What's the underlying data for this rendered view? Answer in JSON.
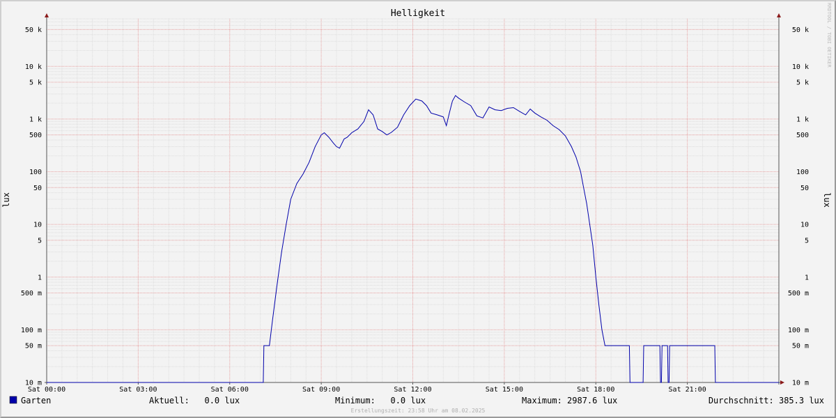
{
  "chart_data": {
    "type": "line",
    "title": "Helligkeit",
    "ylabel": "lux",
    "yscale": "log",
    "ylim": [
      0.01,
      80000
    ],
    "xlim": [
      0,
      24
    ],
    "y_ticks": [
      {
        "value": 50000,
        "label": "50 k"
      },
      {
        "value": 10000,
        "label": "10 k"
      },
      {
        "value": 5000,
        "label": "5 k"
      },
      {
        "value": 1000,
        "label": "1 k"
      },
      {
        "value": 500,
        "label": "500"
      },
      {
        "value": 100,
        "label": "100"
      },
      {
        "value": 50,
        "label": "50"
      },
      {
        "value": 10,
        "label": "10"
      },
      {
        "value": 5,
        "label": "5"
      },
      {
        "value": 1,
        "label": "1"
      },
      {
        "value": 0.5,
        "label": "500 m"
      },
      {
        "value": 0.1,
        "label": "100 m"
      },
      {
        "value": 0.05,
        "label": "50 m"
      },
      {
        "value": 0.01,
        "label": "10 m"
      }
    ],
    "x_ticks": [
      {
        "value": 0,
        "label": "Sat 00:00"
      },
      {
        "value": 3,
        "label": "Sat 03:00"
      },
      {
        "value": 6,
        "label": "Sat 06:00"
      },
      {
        "value": 9,
        "label": "Sat 09:00"
      },
      {
        "value": 12,
        "label": "Sat 12:00"
      },
      {
        "value": 15,
        "label": "Sat 15:00"
      },
      {
        "value": 18,
        "label": "Sat 18:00"
      },
      {
        "value": 21,
        "label": "Sat 21:00"
      }
    ],
    "grid": true,
    "series": [
      {
        "name": "Garten",
        "color": "#0000aa",
        "points": [
          [
            0,
            0.01
          ],
          [
            7.1,
            0.01
          ],
          [
            7.12,
            0.05
          ],
          [
            7.3,
            0.05
          ],
          [
            7.4,
            0.15
          ],
          [
            7.55,
            0.7
          ],
          [
            7.7,
            3
          ],
          [
            7.85,
            10
          ],
          [
            8.0,
            30
          ],
          [
            8.2,
            60
          ],
          [
            8.4,
            90
          ],
          [
            8.6,
            150
          ],
          [
            8.8,
            300
          ],
          [
            9.0,
            500
          ],
          [
            9.1,
            550
          ],
          [
            9.25,
            450
          ],
          [
            9.4,
            350
          ],
          [
            9.5,
            300
          ],
          [
            9.6,
            280
          ],
          [
            9.75,
            420
          ],
          [
            9.85,
            450
          ],
          [
            10.0,
            550
          ],
          [
            10.2,
            650
          ],
          [
            10.4,
            900
          ],
          [
            10.55,
            1500
          ],
          [
            10.7,
            1200
          ],
          [
            10.85,
            650
          ],
          [
            11.0,
            580
          ],
          [
            11.15,
            500
          ],
          [
            11.3,
            560
          ],
          [
            11.5,
            700
          ],
          [
            11.7,
            1200
          ],
          [
            11.9,
            1800
          ],
          [
            12.1,
            2400
          ],
          [
            12.3,
            2200
          ],
          [
            12.45,
            1800
          ],
          [
            12.6,
            1300
          ],
          [
            12.8,
            1200
          ],
          [
            13.0,
            1100
          ],
          [
            13.1,
            750
          ],
          [
            13.2,
            1300
          ],
          [
            13.3,
            2200
          ],
          [
            13.4,
            2800
          ],
          [
            13.5,
            2500
          ],
          [
            13.7,
            2100
          ],
          [
            13.9,
            1800
          ],
          [
            14.1,
            1150
          ],
          [
            14.3,
            1050
          ],
          [
            14.5,
            1700
          ],
          [
            14.7,
            1500
          ],
          [
            14.9,
            1450
          ],
          [
            15.1,
            1600
          ],
          [
            15.3,
            1650
          ],
          [
            15.5,
            1400
          ],
          [
            15.7,
            1200
          ],
          [
            15.85,
            1550
          ],
          [
            16.0,
            1300
          ],
          [
            16.2,
            1100
          ],
          [
            16.4,
            950
          ],
          [
            16.6,
            750
          ],
          [
            16.8,
            630
          ],
          [
            17.0,
            480
          ],
          [
            17.2,
            300
          ],
          [
            17.35,
            190
          ],
          [
            17.5,
            100
          ],
          [
            17.6,
            50
          ],
          [
            17.7,
            25
          ],
          [
            17.8,
            10
          ],
          [
            17.9,
            4
          ],
          [
            18.0,
            1
          ],
          [
            18.1,
            0.3
          ],
          [
            18.2,
            0.1
          ],
          [
            18.3,
            0.05
          ],
          [
            19.1,
            0.05
          ],
          [
            19.12,
            0.01
          ],
          [
            19.55,
            0.01
          ],
          [
            19.57,
            0.05
          ],
          [
            20.1,
            0.05
          ],
          [
            20.12,
            0.01
          ],
          [
            20.15,
            0.01
          ],
          [
            20.17,
            0.05
          ],
          [
            20.35,
            0.05
          ],
          [
            20.37,
            0.01
          ],
          [
            20.4,
            0.01
          ],
          [
            20.42,
            0.05
          ],
          [
            21.9,
            0.05
          ],
          [
            21.92,
            0.01
          ],
          [
            24,
            0.01
          ]
        ]
      }
    ],
    "legend": {
      "series_label": "Garten",
      "aktuell": "Aktuell:   0.0 lux",
      "minimum": "Minimum:   0.0 lux",
      "maximum": "Maximum: 2987.6 lux",
      "durchschnitt": "Durchschnitt: 385.3 lux"
    },
    "footer": "Erstellungszeit: 23:58 Uhr am 08.02.2025",
    "watermark": "RRDTOOL / TOBI OETIKER"
  }
}
